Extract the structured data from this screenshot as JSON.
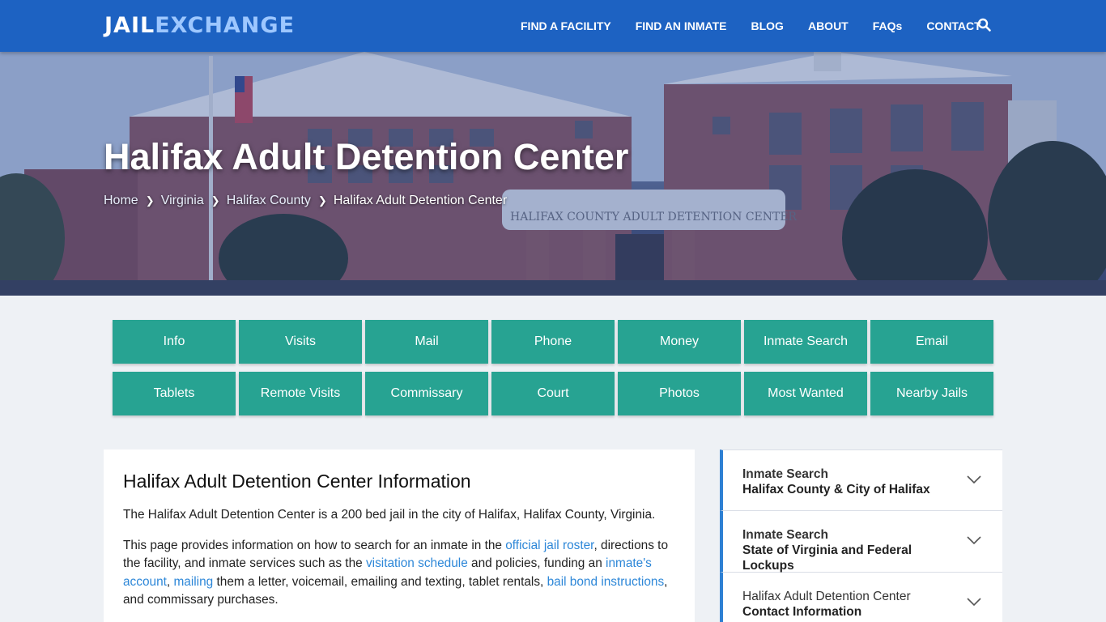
{
  "logo": {
    "part1": "JAIL",
    "part2": "EXCHANGE"
  },
  "nav": [
    "FIND A FACILITY",
    "FIND AN INMATE",
    "BLOG",
    "ABOUT",
    "FAQs",
    "CONTACT"
  ],
  "hero": {
    "title": "Halifax Adult Detention Center",
    "building_sign": "HALIFAX COUNTY ADULT DETENTION CENTER",
    "breadcrumb": [
      "Home",
      "Virginia",
      "Halifax County",
      "Halifax Adult Detention Center"
    ]
  },
  "buttons": {
    "row1": [
      "Info",
      "Visits",
      "Mail",
      "Phone",
      "Money",
      "Inmate Search",
      "Email"
    ],
    "row2": [
      "Tablets",
      "Remote Visits",
      "Commissary",
      "Court",
      "Photos",
      "Most Wanted",
      "Nearby Jails"
    ]
  },
  "info": {
    "heading": "Halifax Adult Detention Center Information",
    "p1": "The Halifax Adult Detention Center is a 200 bed jail in the city of Halifax, Halifax County, Virginia.",
    "p2": {
      "t1": "This page provides information on how to search for an inmate in the ",
      "l1": "official jail roster",
      "t2": ", directions to the facility, and inmate services such as the ",
      "l2": "visitation schedule",
      "t3": " and policies, funding an ",
      "l3": "inmate's account",
      "t4": ", ",
      "l4": "mailing",
      "t5": " them a letter, voicemail, emailing and texting, tablet rentals, ",
      "l5": "bail bond instructions",
      "t6": ", and commissary purchases."
    }
  },
  "sidebar": [
    {
      "line1": "Inmate Search",
      "line2": "Halifax County & City of Halifax"
    },
    {
      "line1": "Inmate Search",
      "line2": "State of Virginia and Federal Lockups"
    },
    {
      "line1": "Halifax Adult Detention Center",
      "line2": "Contact Information"
    }
  ],
  "colors": {
    "nav_bg": "#1d62c2",
    "button_teal": "#27a392",
    "link_blue": "#2d87d8",
    "accent_border": "#2e80d3"
  }
}
